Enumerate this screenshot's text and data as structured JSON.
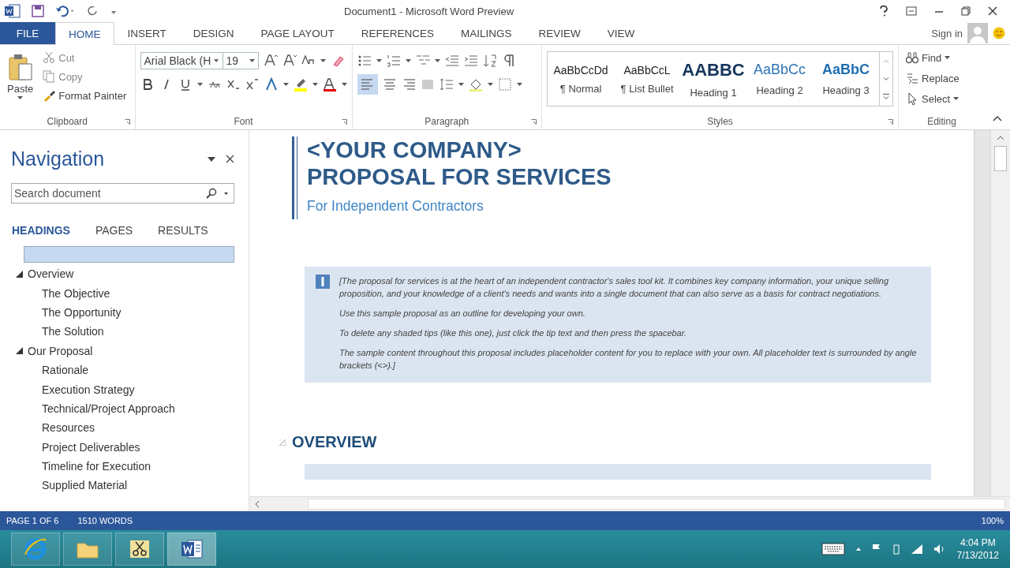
{
  "title_bar": {
    "title": "Document1 - Microsoft Word Preview"
  },
  "ribbon_tabs": [
    {
      "label": "FILE",
      "kind": "file",
      "selected": false
    },
    {
      "label": "HOME",
      "kind": "tab",
      "selected": true
    },
    {
      "label": "INSERT",
      "kind": "tab",
      "selected": false
    },
    {
      "label": "DESIGN",
      "kind": "tab",
      "selected": false
    },
    {
      "label": "PAGE LAYOUT",
      "kind": "tab",
      "selected": false
    },
    {
      "label": "REFERENCES",
      "kind": "tab",
      "selected": false
    },
    {
      "label": "MAILINGS",
      "kind": "tab",
      "selected": false
    },
    {
      "label": "REVIEW",
      "kind": "tab",
      "selected": false
    },
    {
      "label": "VIEW",
      "kind": "tab",
      "selected": false
    }
  ],
  "account": {
    "label": "Sign in"
  },
  "clipboard": {
    "paste": "Paste",
    "cut": "Cut",
    "copy": "Copy",
    "format_painter": "Format Painter",
    "group_label": "Clipboard"
  },
  "font": {
    "font_name": "Arial Black (H",
    "font_size": "19",
    "group_label": "Font"
  },
  "paragraph": {
    "group_label": "Paragraph"
  },
  "styles": {
    "group_label": "Styles",
    "items": [
      {
        "preview": "AaBbCcDd",
        "name": "¶ Normal",
        "kind": "normal"
      },
      {
        "preview": "AaBbCcL",
        "name": "¶ List Bullet",
        "kind": "bullet"
      },
      {
        "preview": "AABBC",
        "name": "Heading 1",
        "kind": "h1"
      },
      {
        "preview": "AaBbCc",
        "name": "Heading 2",
        "kind": "h2"
      },
      {
        "preview": "AaBbC",
        "name": "Heading 3",
        "kind": "h3"
      }
    ]
  },
  "editing": {
    "find": "Find",
    "replace": "Replace",
    "select": "Select",
    "group_label": "Editing"
  },
  "navigation": {
    "title": "Navigation",
    "search": {
      "placeholder": "Search document"
    },
    "tabs": [
      {
        "label": "HEADINGS",
        "selected": true
      },
      {
        "label": "PAGES",
        "selected": false
      },
      {
        "label": "RESULTS",
        "selected": false
      }
    ],
    "blank_heading_selected": true,
    "headings": [
      {
        "label": "Overview",
        "expanded": true,
        "children": [
          {
            "label": "The Objective"
          },
          {
            "label": "The Opportunity"
          },
          {
            "label": "The Solution"
          }
        ]
      },
      {
        "label": "Our Proposal",
        "expanded": true,
        "children": [
          {
            "label": "Rationale"
          },
          {
            "label": "Execution Strategy"
          },
          {
            "label": "Technical/Project Approach"
          },
          {
            "label": "Resources"
          },
          {
            "label": "Project Deliverables"
          },
          {
            "label": "Timeline for Execution"
          },
          {
            "label": "Supplied Material"
          }
        ]
      }
    ]
  },
  "document": {
    "company": "<YOUR COMPANY>",
    "title": "PROPOSAL FOR SERVICES",
    "subtitle": "For Independent Contractors",
    "tip": [
      "[The proposal for services is at the heart of an independent contractor's sales tool kit. It combines key company information, your unique selling proposition, and your knowledge of a client's needs and wants into a single document that can also serve as a basis for contract negotiations.",
      "Use this sample proposal as an outline for developing your own.",
      "To delete any shaded tips (like this one), just click the tip text and then press the spacebar.",
      "The sample content throughout this proposal includes placeholder content for you to replace with your own. All placeholder text is surrounded by angle brackets (<>).]"
    ],
    "section_heading": "OVERVIEW"
  },
  "status_bar": {
    "page": "PAGE 1 OF 6",
    "words": "1510 WORDS",
    "zoom": "100%"
  },
  "taskbar": {
    "apps": [
      {
        "kind": "browser",
        "selected": false
      },
      {
        "kind": "folder",
        "selected": false
      },
      {
        "kind": "snipping",
        "selected": false
      },
      {
        "kind": "word",
        "selected": true
      }
    ],
    "time": "4:04 PM",
    "date": "7/13/2012"
  }
}
